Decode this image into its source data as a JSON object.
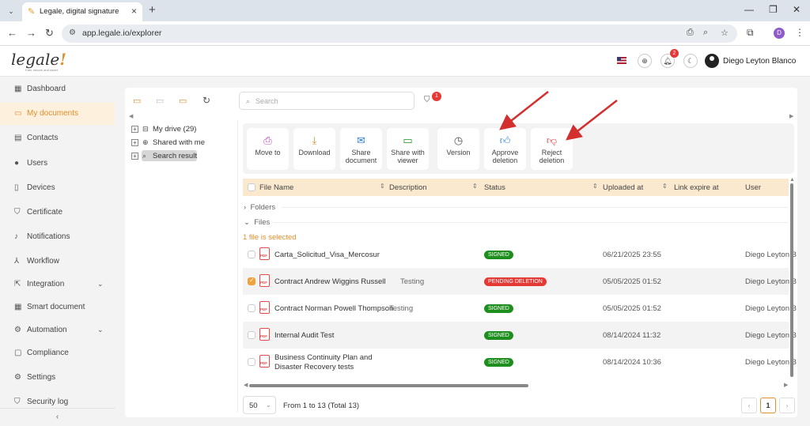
{
  "browser": {
    "tab_title": "Legale, digital signature",
    "url": "app.legale.io/explorer",
    "profile_initial": "D"
  },
  "header": {
    "logo_text": "legale",
    "logo_tagline": "Fast, secure and smart",
    "notification_count": "2",
    "user_name": "Diego Leyton Blanco"
  },
  "sidebar": {
    "items": [
      {
        "label": "Dashboard",
        "icon": "dashboard-icon"
      },
      {
        "label": "My documents",
        "icon": "folder-icon"
      },
      {
        "label": "Contacts",
        "icon": "contacts-icon"
      },
      {
        "label": "Users",
        "icon": "user-icon"
      },
      {
        "label": "Devices",
        "icon": "device-icon"
      },
      {
        "label": "Certificate",
        "icon": "certificate-icon"
      },
      {
        "label": "Notifications",
        "icon": "bell-icon"
      },
      {
        "label": "Workflow",
        "icon": "workflow-icon"
      },
      {
        "label": "Integration",
        "icon": "integration-icon"
      },
      {
        "label": "Smart document",
        "icon": "smart-document-icon"
      },
      {
        "label": "Automation",
        "icon": "automation-icon"
      },
      {
        "label": "Compliance",
        "icon": "compliance-icon"
      },
      {
        "label": "Settings",
        "icon": "gear-icon"
      },
      {
        "label": "Security log",
        "icon": "shield-icon"
      }
    ]
  },
  "search": {
    "placeholder": "Search"
  },
  "filter": {
    "badge": "1"
  },
  "tree": {
    "my_drive": "My drive (29)",
    "shared": "Shared with me",
    "search_result": "Search result"
  },
  "actions": {
    "move_to": "Move to",
    "download": "Download",
    "share_document": "Share document",
    "share_with_viewer": "Share with viewer",
    "version": "Version",
    "approve_deletion": "Approve deletion",
    "reject_deletion": "Reject deletion"
  },
  "table": {
    "headers": {
      "file_name": "File Name",
      "description": "Description",
      "status": "Status",
      "uploaded_at": "Uploaded at",
      "link_expire_at": "Link expire at",
      "user": "User"
    },
    "folders_label": "Folders",
    "files_label": "Files",
    "selected_info": "1 file is selected",
    "rows": [
      {
        "name": "Carta_Solicitud_Visa_Mercosur",
        "description": "",
        "status": "SIGNED",
        "uploaded": "06/21/2025 23:55",
        "user": "Diego Leyton B"
      },
      {
        "name": "Contract Andrew Wiggins Russell",
        "description": "Testing",
        "status": "PENDING DELETION",
        "uploaded": "05/05/2025 01:52",
        "user": "Diego Leyton B"
      },
      {
        "name": "Contract Norman Powell Thompson",
        "description": "Testing",
        "status": "SIGNED",
        "uploaded": "05/05/2025 01:52",
        "user": "Diego Leyton B"
      },
      {
        "name": "Internal Audit Test",
        "description": "",
        "status": "SIGNED",
        "uploaded": "08/14/2024 11:32",
        "user": "Diego Leyton B"
      },
      {
        "name_line1": "Business Continuity Plan and",
        "name_line2": "Disaster Recovery tests",
        "description": "",
        "status": "SIGNED",
        "uploaded": "08/14/2024 10:36",
        "user": "Diego Leyton B"
      }
    ]
  },
  "pager": {
    "page_size": "50",
    "info": "From 1 to 13 (Total 13)",
    "current_page": "1"
  },
  "colors": {
    "accent": "#e0902c",
    "signed": "#1e8e1e",
    "pending_deletion": "#e53935",
    "annotation_arrow": "#d32f2f"
  }
}
